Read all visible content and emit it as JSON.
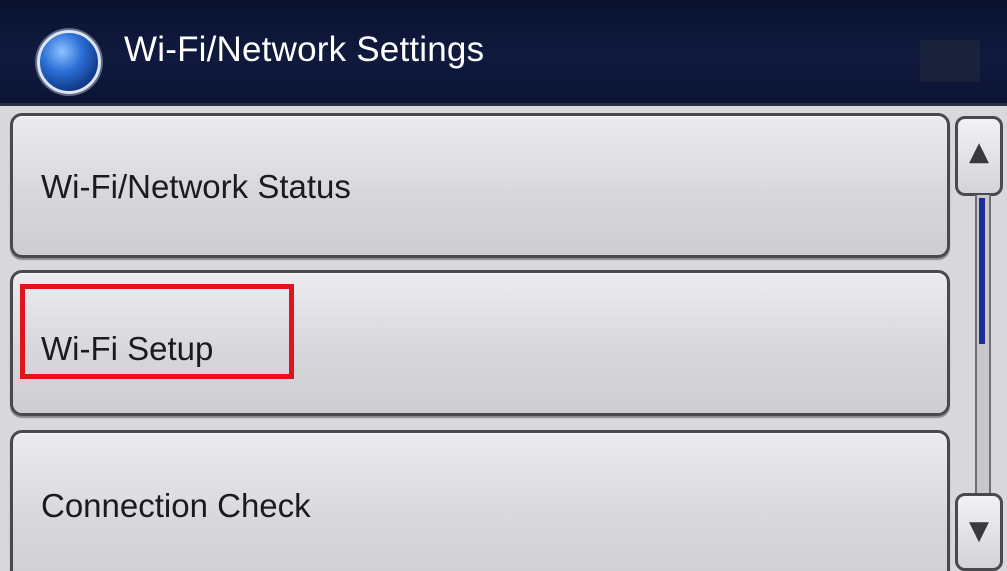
{
  "header": {
    "title": "Wi-Fi/Network Settings",
    "icon": "globe-icon"
  },
  "menu": {
    "items": [
      {
        "label": "Wi-Fi/Network Status"
      },
      {
        "label": "Wi-Fi Setup",
        "highlighted": true
      },
      {
        "label": "Connection Check"
      }
    ]
  },
  "scrollbar": {
    "up_icon": "triangle-up-icon",
    "down_icon": "triangle-down-icon"
  },
  "colors": {
    "header_bg": "#101a3e",
    "highlight": "#e2141b",
    "scroll_thumb": "#1c2e9a"
  }
}
